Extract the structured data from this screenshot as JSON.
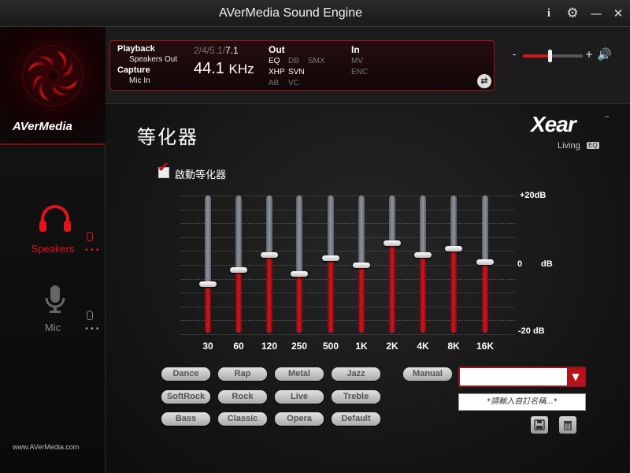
{
  "window": {
    "title": "AVerMedia Sound Engine",
    "info_icon": "i",
    "settings_icon": "gear-icon",
    "minimize_icon": "—",
    "close_icon": "✕"
  },
  "sidebar": {
    "brand": "AVerMedia",
    "website": "www.AVerMedia.com",
    "items": [
      {
        "label": "Speakers",
        "icon": "headphones-icon",
        "active": true,
        "dots": "•••"
      },
      {
        "label": "Mic",
        "icon": "microphone-icon",
        "active": false,
        "dots": "•••"
      }
    ]
  },
  "info": {
    "playback_label": "Playback",
    "playback_device": "Speakers Out",
    "capture_label": "Capture",
    "capture_device": "Mic In",
    "channels_dim": "2/4/5.1/",
    "channels_active": "7.1",
    "sample_rate": "44.1",
    "sample_unit": "KHz",
    "out_label": "Out",
    "out_eq": "EQ",
    "out_db": "DB",
    "out_smx": "SMX",
    "out_xhp": "XHP",
    "out_svn": "SVN",
    "out_ab": "AB",
    "out_vc": "VC",
    "in_label": "In",
    "in_mv": "MV",
    "in_enc": "ENC"
  },
  "volume": {
    "minus": "-",
    "plus": "+",
    "level": 0.45,
    "icon": "speaker-icon"
  },
  "equalizer": {
    "title": "等化器",
    "enable_label": "啟動等化器",
    "enabled": true,
    "db_top": "+20dB",
    "db_zero": "0",
    "db_zero_unit": "dB",
    "db_bottom": "-20 dB",
    "bands": [
      {
        "freq": "30",
        "gain": -5.5
      },
      {
        "freq": "60",
        "gain": -1.5
      },
      {
        "freq": "120",
        "gain": 3
      },
      {
        "freq": "250",
        "gain": -2.5
      },
      {
        "freq": "500",
        "gain": 2
      },
      {
        "freq": "1K",
        "gain": 0
      },
      {
        "freq": "2K",
        "gain": 6.5
      },
      {
        "freq": "4K",
        "gain": 3
      },
      {
        "freq": "8K",
        "gain": 5
      },
      {
        "freq": "16K",
        "gain": 1
      }
    ]
  },
  "presets": {
    "row1": [
      "Dance",
      "Rap",
      "Metal",
      "Jazz"
    ],
    "row2": [
      "SoftRock",
      "Rock",
      "Live",
      "Treble"
    ],
    "row3": [
      "Bass",
      "Classic",
      "Opera",
      "Default"
    ],
    "manual": "Manual",
    "custom_name_placeholder": "*請輸入自訂名稱...*",
    "save_icon": "save-icon",
    "delete_icon": "trash-icon"
  },
  "logo": {
    "xear": "Xear",
    "tm": "™",
    "living": "Living",
    "eq": "EQ"
  }
}
